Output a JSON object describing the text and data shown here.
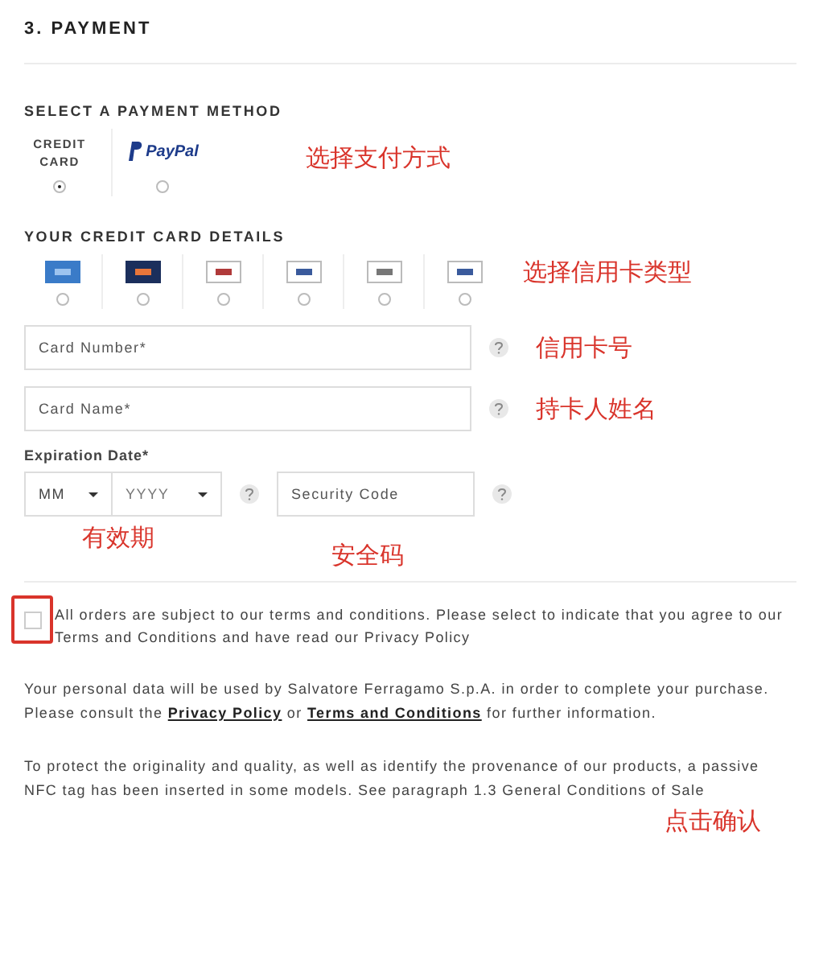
{
  "section_title": "3. PAYMENT",
  "method_heading": "SELECT A PAYMENT METHOD",
  "methods": [
    {
      "kind": "credit",
      "label": "CREDIT CARD",
      "selected": true
    },
    {
      "kind": "paypal",
      "label": "PayPal",
      "selected": false
    }
  ],
  "method_note": "选择支付方式",
  "card_heading": "YOUR CREDIT CARD DETAILS",
  "card_types": [
    {
      "selected": false
    },
    {
      "selected": false
    },
    {
      "selected": false
    },
    {
      "selected": false
    },
    {
      "selected": false
    },
    {
      "selected": false
    }
  ],
  "card_type_note": "选择信用卡类型",
  "fields": [
    {
      "placeholder": "Card Number*",
      "note": "信用卡号"
    },
    {
      "placeholder": "Card Name*",
      "note": "持卡人姓名"
    }
  ],
  "expiration": {
    "label": "Expiration Date*",
    "month": "MM",
    "year": "YYYY",
    "security_placeholder": "Security Code"
  },
  "expiration_notes": [
    "有效期",
    "安全码"
  ],
  "agree": {
    "checked": false,
    "highlighted": true,
    "text": "All orders are subject to our terms and conditions. Please select to indicate that you agree to our Terms and Conditions and have read our Privacy Policy"
  },
  "privacy_note": [
    {
      "kind": "text",
      "text": "Your personal data will be used by Salvatore Ferragamo S.p.A. in order to complete your purchase. Please consult the "
    },
    {
      "kind": "link",
      "text": "Privacy Policy"
    },
    {
      "kind": "text",
      "text": " or "
    },
    {
      "kind": "link",
      "text": "Terms and Conditions"
    },
    {
      "kind": "text",
      "text": " for further information."
    }
  ],
  "nfc_note": "To protect the originality and quality, as well as identify the provenance of our products, a passive NFC tag has been inserted in some models. See paragraph 1.3 General Conditions of Sale",
  "confirm_note": "点击确认"
}
